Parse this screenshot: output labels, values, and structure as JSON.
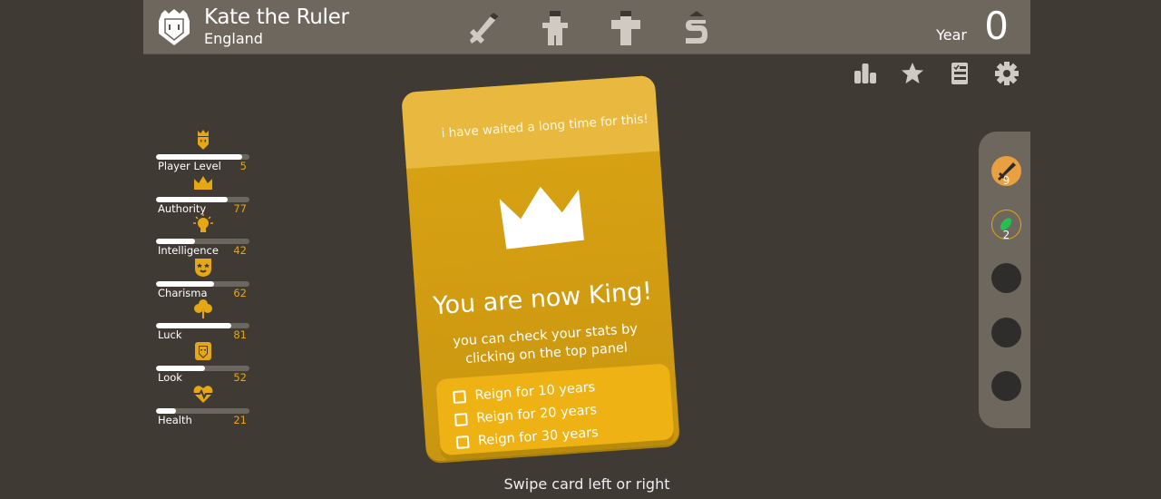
{
  "header": {
    "ruler_name": "Kate the Ruler",
    "country": "England",
    "avatar_icon": "queen-shield-icon",
    "resources": [
      {
        "name": "military",
        "icon": "sword-icon",
        "level": 0.78
      },
      {
        "name": "people",
        "icon": "person-icon",
        "level": 0.8
      },
      {
        "name": "church",
        "icon": "cross-icon",
        "level": 0.8
      },
      {
        "name": "treasury",
        "icon": "dollar-icon",
        "level": 0.85
      }
    ],
    "year_label": "Year",
    "year_value": "0"
  },
  "toolbar": [
    {
      "name": "stats",
      "icon": "bar-chart-icon"
    },
    {
      "name": "achievements",
      "icon": "star-icon"
    },
    {
      "name": "goals",
      "icon": "checklist-icon"
    },
    {
      "name": "settings",
      "icon": "gear-icon"
    }
  ],
  "stats": [
    {
      "label": "Player Level",
      "value": "5",
      "fill": 0.92,
      "icon": "crowned-face-icon"
    },
    {
      "label": "Authority",
      "value": "77",
      "fill": 0.77,
      "icon": "crown-icon"
    },
    {
      "label": "Intelligence",
      "value": "42",
      "fill": 0.42,
      "icon": "lightbulb-icon"
    },
    {
      "label": "Charisma",
      "value": "62",
      "fill": 0.62,
      "icon": "charisma-mask-icon"
    },
    {
      "label": "Luck",
      "value": "81",
      "fill": 0.81,
      "icon": "clover-icon"
    },
    {
      "label": "Look",
      "value": "52",
      "fill": 0.52,
      "icon": "mirror-face-icon"
    },
    {
      "label": "Health",
      "value": "21",
      "fill": 0.21,
      "icon": "heartbeat-icon"
    }
  ],
  "card": {
    "quote": "i have waited a long time for this!",
    "title": "You are now King!",
    "subtitle": "you can check your stats by clicking on the top panel",
    "goals": [
      "Reign for 10 years",
      "Reign for 20 years",
      "Reign for 30 years"
    ]
  },
  "hint": "Swipe card left or right",
  "side_slots": [
    {
      "icon": "sword-icon",
      "count": "9",
      "color": "#e8a040"
    },
    {
      "icon": "leaf-icon",
      "count": "2",
      "color": "#6e675e"
    },
    {
      "icon": "empty-slot",
      "count": null
    },
    {
      "icon": "empty-slot",
      "count": null
    },
    {
      "icon": "empty-slot",
      "count": null
    }
  ],
  "colors": {
    "accent": "#e5a713",
    "card": "#dba415",
    "panel": "#6e675e",
    "background": "#3f3a34"
  }
}
